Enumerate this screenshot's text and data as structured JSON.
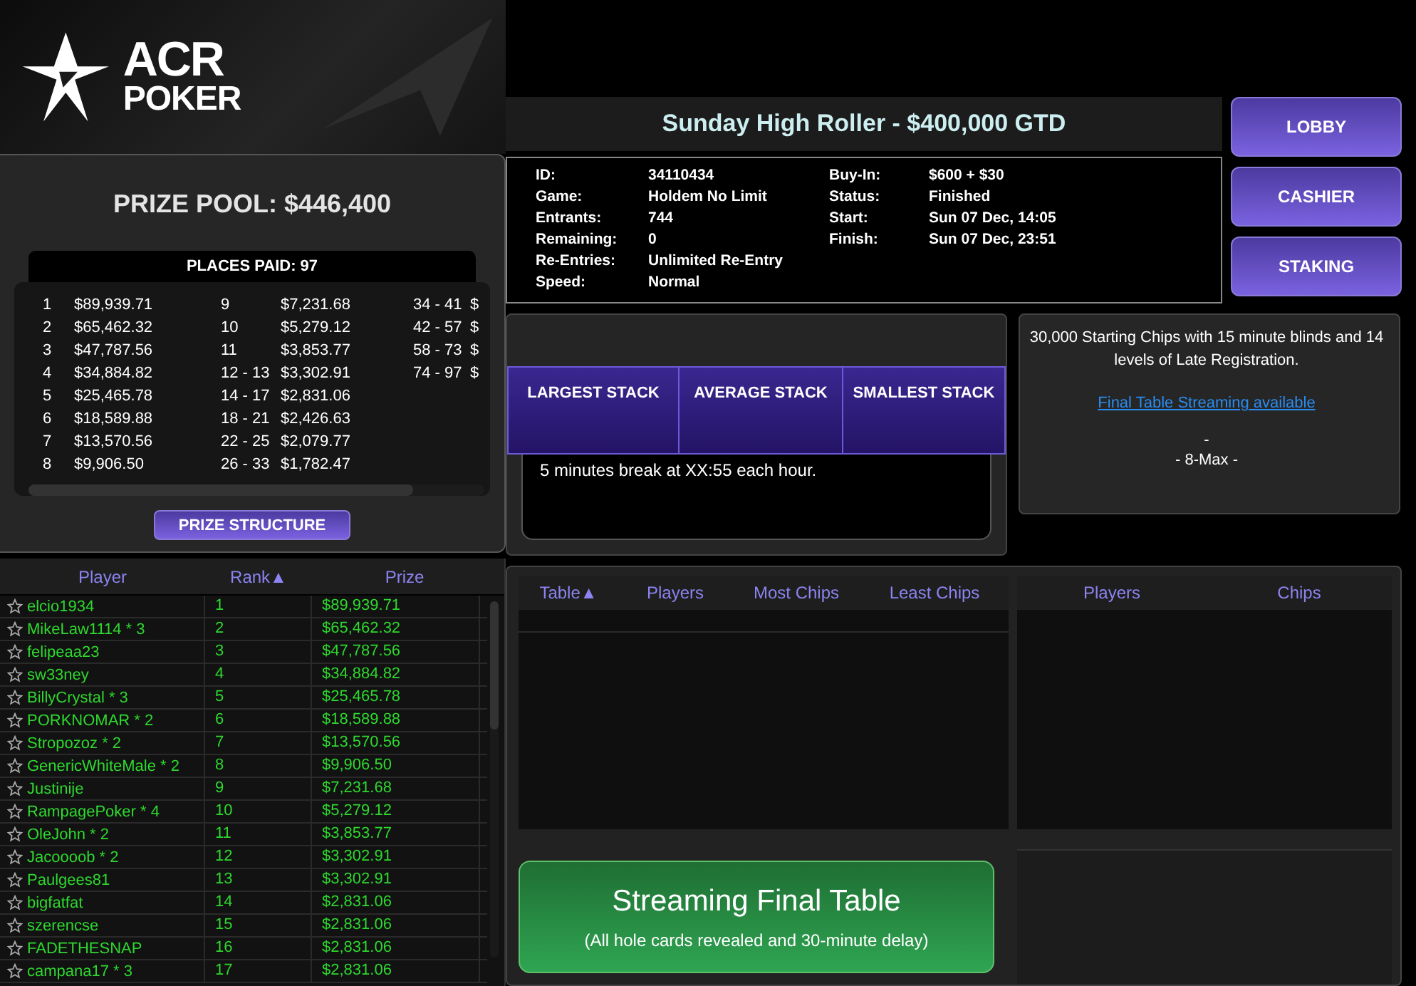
{
  "logo": {
    "line_1": "ACR",
    "line_2": "POKER"
  },
  "prize_pool": {
    "title": "PRIZE POOL: $446,400",
    "places_paid": "PLACES PAID: 97",
    "columns": [
      [
        {
          "place": "1",
          "prize": "$89,939.71"
        },
        {
          "place": "2",
          "prize": "$65,462.32"
        },
        {
          "place": "3",
          "prize": "$47,787.56"
        },
        {
          "place": "4",
          "prize": "$34,884.82"
        },
        {
          "place": "5",
          "prize": "$25,465.78"
        },
        {
          "place": "6",
          "prize": "$18,589.88"
        },
        {
          "place": "7",
          "prize": "$13,570.56"
        },
        {
          "place": "8",
          "prize": "$9,906.50"
        }
      ],
      [
        {
          "place": "9",
          "prize": "$7,231.68"
        },
        {
          "place": "10",
          "prize": "$5,279.12"
        },
        {
          "place": "11",
          "prize": "$3,853.77"
        },
        {
          "place": "12 - 13",
          "prize": "$3,302.91"
        },
        {
          "place": "14 - 17",
          "prize": "$2,831.06"
        },
        {
          "place": "18 - 21",
          "prize": "$2,426.63"
        },
        {
          "place": "22 - 25",
          "prize": "$2,079.77"
        },
        {
          "place": "26 - 33",
          "prize": "$1,782.47"
        }
      ],
      [
        {
          "place": "34 - 41",
          "prize": "$"
        },
        {
          "place": "42 - 57",
          "prize": "$"
        },
        {
          "place": "58 - 73",
          "prize": "$"
        },
        {
          "place": "74 - 97",
          "prize": "$"
        }
      ]
    ],
    "button": "PRIZE STRUCTURE"
  },
  "players": {
    "columns": [
      "Player",
      "Rank▲",
      "Prize"
    ],
    "rows": [
      {
        "name": "elcio1934",
        "rank": "1",
        "prize": "$89,939.71"
      },
      {
        "name": "MikeLaw1114 * 3",
        "rank": "2",
        "prize": "$65,462.32"
      },
      {
        "name": "felipeaa23",
        "rank": "3",
        "prize": "$47,787.56"
      },
      {
        "name": "sw33ney",
        "rank": "4",
        "prize": "$34,884.82"
      },
      {
        "name": "BillyCrystal * 3",
        "rank": "5",
        "prize": "$25,465.78"
      },
      {
        "name": "PORKNOMAR * 2",
        "rank": "6",
        "prize": "$18,589.88"
      },
      {
        "name": "Stropozoz * 2",
        "rank": "7",
        "prize": "$13,570.56"
      },
      {
        "name": "GenericWhiteMale * 2",
        "rank": "8",
        "prize": "$9,906.50"
      },
      {
        "name": "Justinije",
        "rank": "9",
        "prize": "$7,231.68"
      },
      {
        "name": "RampagePoker * 4",
        "rank": "10",
        "prize": "$5,279.12"
      },
      {
        "name": "OleJohn * 2",
        "rank": "11",
        "prize": "$3,853.77"
      },
      {
        "name": "Jacoooob * 2",
        "rank": "12",
        "prize": "$3,302.91"
      },
      {
        "name": "Paulgees81",
        "rank": "13",
        "prize": "$3,302.91"
      },
      {
        "name": "bigfatfat",
        "rank": "14",
        "prize": "$2,831.06"
      },
      {
        "name": "szerencse",
        "rank": "15",
        "prize": "$2,831.06"
      },
      {
        "name": "FADETHESNAP",
        "rank": "16",
        "prize": "$2,831.06"
      },
      {
        "name": "campana17 * 3",
        "rank": "17",
        "prize": "$2,831.06"
      }
    ]
  },
  "tournament": {
    "title": "Sunday High Roller - $400,000 GTD",
    "details_left": [
      {
        "label": "ID:",
        "value": "34110434"
      },
      {
        "label": "Game:",
        "value": "Holdem No Limit"
      },
      {
        "label": "Entrants:",
        "value": "744"
      },
      {
        "label": "Remaining:",
        "value": "0"
      },
      {
        "label": "Re-Entries:",
        "value": "Unlimited Re-Entry"
      },
      {
        "label": "Speed:",
        "value": "Normal"
      }
    ],
    "details_right": [
      {
        "label": "Buy-In:",
        "value": "$600 + $30"
      },
      {
        "label": "Status:",
        "value": "Finished"
      },
      {
        "label": "Start:",
        "value": "Sun 07 Dec, 14:05"
      },
      {
        "label": "Finish:",
        "value": "Sun 07 Dec, 23:51"
      }
    ]
  },
  "nav_buttons": [
    "LOBBY",
    "CASHIER",
    "STAKING"
  ],
  "stacks": {
    "headers": [
      "LARGEST STACK",
      "AVERAGE STACK",
      "SMALLEST STACK"
    ],
    "note": "5 minutes break at XX:55 each hour."
  },
  "description": {
    "text": "30,000 Starting Chips with 15 minute blinds and 14 levels of Late Registration.",
    "link": "Final Table Streaming available",
    "separator": "-",
    "format": "- 8-Max -"
  },
  "tables": {
    "columns": [
      "Table▲",
      "Players",
      "Most Chips",
      "Least Chips"
    ]
  },
  "table_players": {
    "columns": [
      "Players",
      "Chips"
    ]
  },
  "stream_button": {
    "title": "Streaming Final Table",
    "subtitle": "(All hole cards revealed and 30-minute delay)"
  }
}
